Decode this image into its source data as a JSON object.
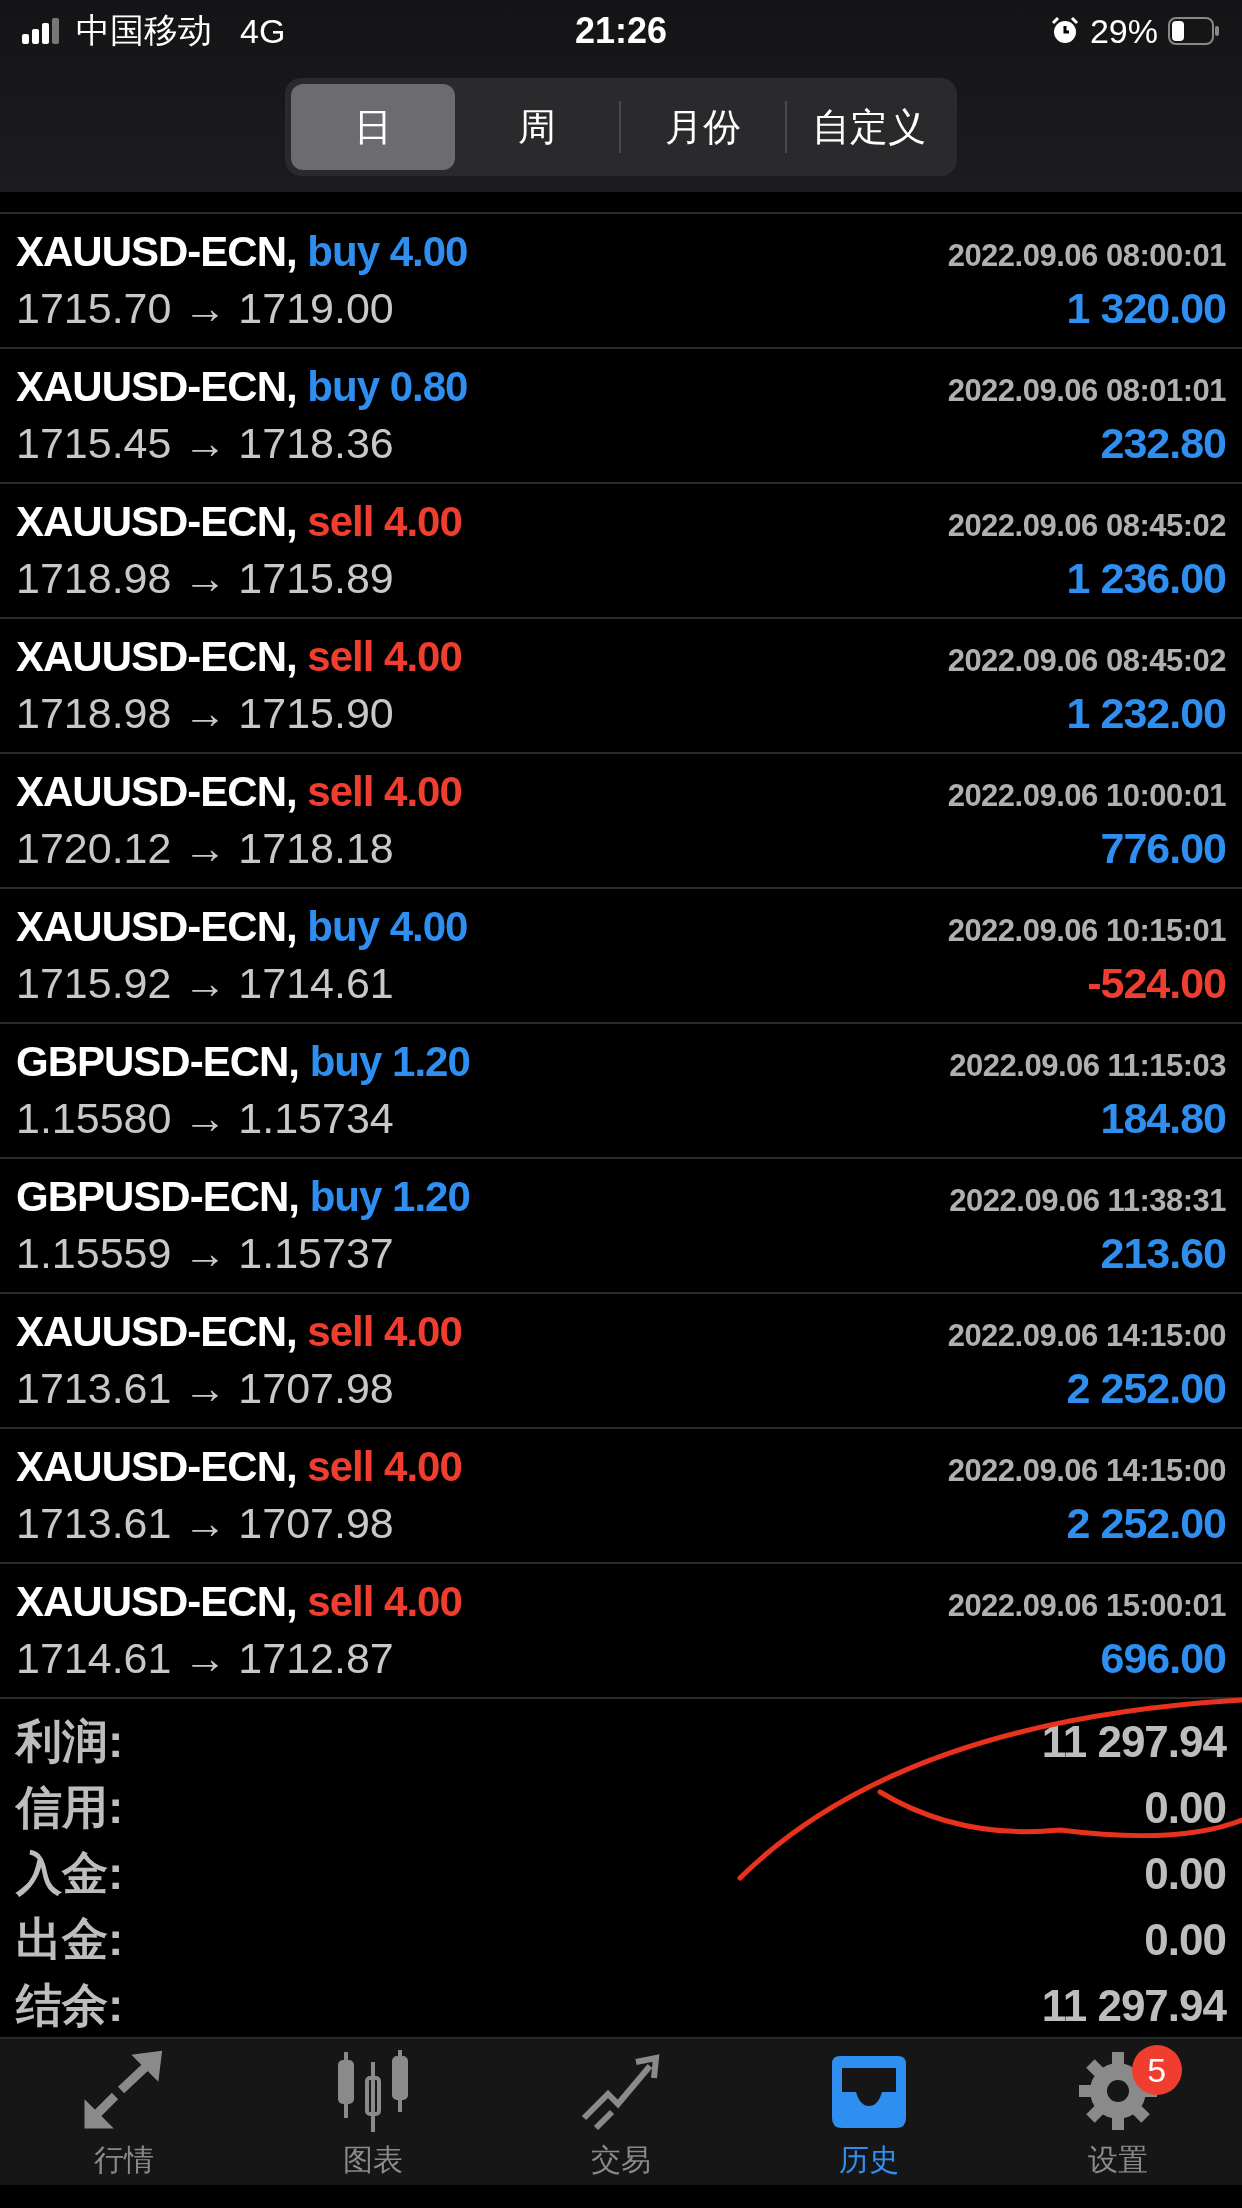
{
  "status_bar": {
    "carrier": "中国移动",
    "network": "4G",
    "time": "21:26",
    "battery": "29%"
  },
  "period_tabs": [
    {
      "label": "日",
      "selected": true
    },
    {
      "label": "周",
      "selected": false
    },
    {
      "label": "月份",
      "selected": false
    },
    {
      "label": "自定义",
      "selected": false
    }
  ],
  "deals": [
    {
      "symbol": "XAUUSD-ECN,",
      "side": "buy",
      "volume": "4.00",
      "time": "2022.09.06 08:00:01",
      "prices": "1715.70 → 1719.00",
      "profit": "1 320.00",
      "loss": false
    },
    {
      "symbol": "XAUUSD-ECN,",
      "side": "buy",
      "volume": "0.80",
      "time": "2022.09.06 08:01:01",
      "prices": "1715.45 → 1718.36",
      "profit": "232.80",
      "loss": false
    },
    {
      "symbol": "XAUUSD-ECN,",
      "side": "sell",
      "volume": "4.00",
      "time": "2022.09.06 08:45:02",
      "prices": "1718.98 → 1715.89",
      "profit": "1 236.00",
      "loss": false
    },
    {
      "symbol": "XAUUSD-ECN,",
      "side": "sell",
      "volume": "4.00",
      "time": "2022.09.06 08:45:02",
      "prices": "1718.98 → 1715.90",
      "profit": "1 232.00",
      "loss": false
    },
    {
      "symbol": "XAUUSD-ECN,",
      "side": "sell",
      "volume": "4.00",
      "time": "2022.09.06 10:00:01",
      "prices": "1720.12 → 1718.18",
      "profit": "776.00",
      "loss": false
    },
    {
      "symbol": "XAUUSD-ECN,",
      "side": "buy",
      "volume": "4.00",
      "time": "2022.09.06 10:15:01",
      "prices": "1715.92 → 1714.61",
      "profit": "-524.00",
      "loss": true
    },
    {
      "symbol": "GBPUSD-ECN,",
      "side": "buy",
      "volume": "1.20",
      "time": "2022.09.06 11:15:03",
      "prices": "1.15580 → 1.15734",
      "profit": "184.80",
      "loss": false
    },
    {
      "symbol": "GBPUSD-ECN,",
      "side": "buy",
      "volume": "1.20",
      "time": "2022.09.06 11:38:31",
      "prices": "1.15559 → 1.15737",
      "profit": "213.60",
      "loss": false
    },
    {
      "symbol": "XAUUSD-ECN,",
      "side": "sell",
      "volume": "4.00",
      "time": "2022.09.06 14:15:00",
      "prices": "1713.61 → 1707.98",
      "profit": "2 252.00",
      "loss": false
    },
    {
      "symbol": "XAUUSD-ECN,",
      "side": "sell",
      "volume": "4.00",
      "time": "2022.09.06 14:15:00",
      "prices": "1713.61 → 1707.98",
      "profit": "2 252.00",
      "loss": false
    },
    {
      "symbol": "XAUUSD-ECN,",
      "side": "sell",
      "volume": "4.00",
      "time": "2022.09.06 15:00:01",
      "prices": "1714.61 → 1712.87",
      "profit": "696.00",
      "loss": false
    }
  ],
  "summary": [
    {
      "label": "利润:",
      "value": "11 297.94"
    },
    {
      "label": "信用:",
      "value": "0.00"
    },
    {
      "label": "入金:",
      "value": "0.00"
    },
    {
      "label": "出金:",
      "value": "0.00"
    },
    {
      "label": "结余:",
      "value": "11 297.94"
    }
  ],
  "tab_bar": [
    {
      "kind": "quotes",
      "label": "行情",
      "selected": false
    },
    {
      "kind": "chart",
      "label": "图表",
      "selected": false
    },
    {
      "kind": "trade",
      "label": "交易",
      "selected": false
    },
    {
      "kind": "history",
      "label": "历史",
      "selected": true
    },
    {
      "kind": "settings",
      "label": "设置",
      "selected": false,
      "badge": "5"
    }
  ]
}
